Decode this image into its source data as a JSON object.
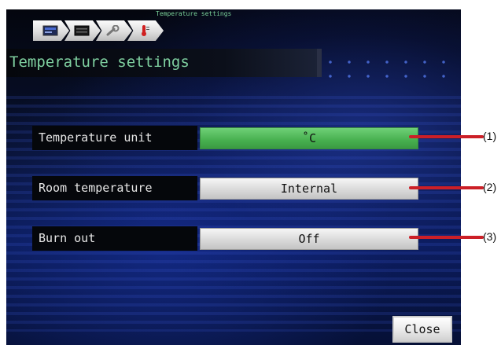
{
  "breadcrumb": {
    "title": "Temperature settings",
    "items": [
      {
        "icon": "monitor-icon"
      },
      {
        "icon": "dark-display-icon"
      },
      {
        "icon": "wrench-icon"
      },
      {
        "icon": "thermometer-icon"
      }
    ]
  },
  "header": {
    "title": "Temperature settings"
  },
  "settings": [
    {
      "label": "Temperature unit",
      "value": "˚C",
      "active": true
    },
    {
      "label": "Room temperature",
      "value": "Internal",
      "active": false
    },
    {
      "label": "Burn out",
      "value": "Off",
      "active": false
    }
  ],
  "callouts": [
    "(1)",
    "(2)",
    "(3)"
  ],
  "close_label": "Close",
  "colors": {
    "accent_green": "#47b04f",
    "callout_red": "#cc1f27",
    "title_green": "#7fd0a0"
  }
}
